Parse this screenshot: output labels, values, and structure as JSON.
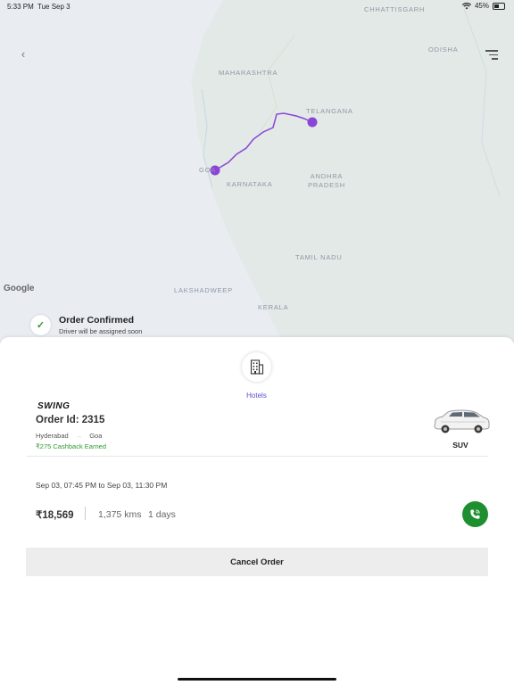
{
  "status_bar": {
    "time": "5:33 PM",
    "date": "Tue Sep 3",
    "battery": "45%",
    "battery_level": 0.45
  },
  "map": {
    "labels": [
      "CHHATTISGARH",
      "ODISHA",
      "MAHARASHTRA",
      "TELANGANA",
      "GOA",
      "KARNATAKA",
      "ANDHRA PRADESH",
      "TAMIL NADU",
      "LAKSHADWEEP",
      "KERALA"
    ],
    "provider": "Google",
    "route_color": "#8a45d8"
  },
  "order_status": {
    "title": "Order Confirmed",
    "subtitle": "Driver will be assigned soon"
  },
  "services": [
    {
      "label": "Hotels",
      "icon": "building-icon"
    }
  ],
  "order": {
    "brand": "SWING",
    "order_id": "Order Id: 2315",
    "from": "Hyderabad",
    "to": "Goa",
    "cashback": "₹275 Cashback Earned",
    "vehicle": "SUV",
    "schedule": "Sep 03, 07:45 PM to Sep 03, 11:30 PM",
    "price": "₹18,569",
    "distance": "1,375 kms",
    "duration": "1 days"
  },
  "actions": {
    "cancel_label": "Cancel Order"
  },
  "colors": {
    "accent": "#5a4fcf",
    "success": "#2e9b2e",
    "call_button": "#1e8f2f"
  }
}
